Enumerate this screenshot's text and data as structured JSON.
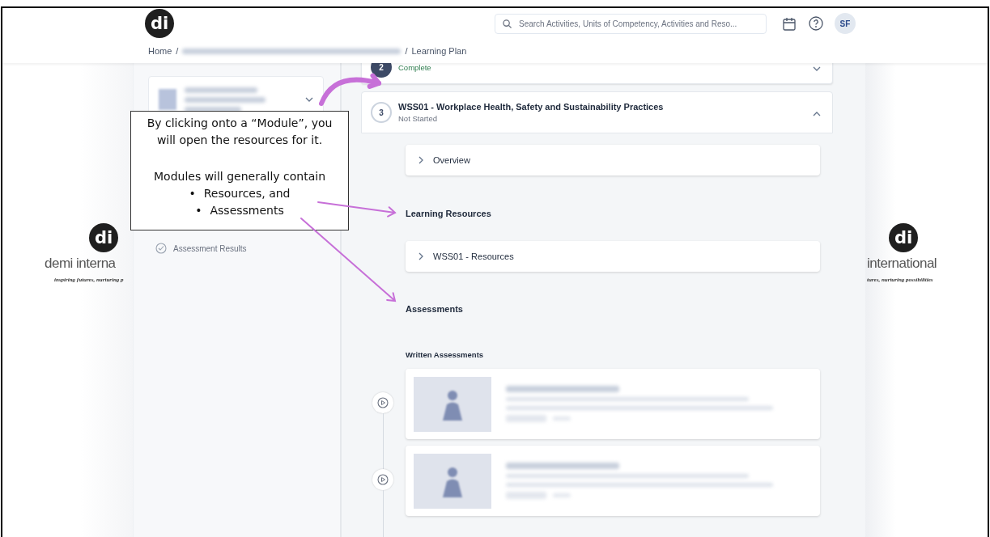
{
  "header": {
    "logo": "di",
    "search": {
      "placeholder": "Search Activities, Units of Competency, Activities and Reso..."
    },
    "avatar": "SF"
  },
  "breadcrumb": {
    "home": "Home",
    "separator": "/",
    "current": "Learning Plan"
  },
  "background_logos": [
    {
      "mark": "di",
      "name": "demi interna",
      "tagline": "inspiring futures, nurturing p"
    },
    {
      "mark": "di",
      "name": "international",
      "tagline": "tures, nurturing possibilities"
    }
  ],
  "sidebar": {
    "items": [
      {
        "label": "Assessment Results"
      }
    ]
  },
  "modules": [
    {
      "number": "2",
      "status": "Complete",
      "kind": "complete",
      "expanded": false
    },
    {
      "number": "3",
      "title": "WSS01 - Workplace Health, Safety and Sustainability Practices",
      "status": "Not Started",
      "kind": "not_started",
      "expanded": true
    }
  ],
  "module_content": {
    "overview": "Overview",
    "resources_heading": "Learning Resources",
    "resources": "WSS01 - Resources",
    "assessments_heading": "Assessments",
    "written_heading": "Written Assessments",
    "assessments": [
      {
        "kind": "quiz"
      },
      {
        "kind": "quiz"
      }
    ]
  },
  "annotation": {
    "intro": "By clicking onto a “Module”, you will open the resources for it.",
    "lead": "Modules will generally contain",
    "bullet": "•",
    "points": [
      "Resources, and",
      "Assessments"
    ]
  }
}
